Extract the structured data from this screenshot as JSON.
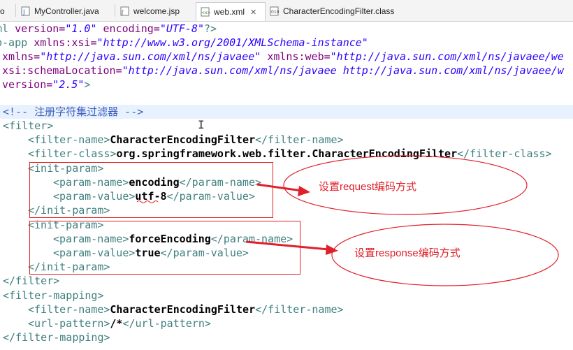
{
  "tabs": [
    {
      "label": "o",
      "icon": "java-file-icon"
    },
    {
      "label": "MyController.java",
      "icon": "java-file-icon"
    },
    {
      "label": "welcome.jsp",
      "icon": "jsp-file-icon"
    },
    {
      "label": "web.xml",
      "icon": "xml-file-icon",
      "close": "✕"
    },
    {
      "label": "CharacterEncodingFilter.class",
      "icon": "class-file-icon"
    }
  ],
  "code": {
    "l1": [
      "ml ",
      "version=",
      "\"1.0\"",
      " encoding=",
      "\"UTF-8\"",
      "?>"
    ],
    "l2": [
      "b-app ",
      "xmlns:xsi=",
      "\"http://www.w3.org/2001/XMLSchema-instance\""
    ],
    "l3": [
      " xmlns=",
      "\"http://java.sun.com/xml/ns/javaee\"",
      " xmlns:web=",
      "\"http://java.sun.com/xml/ns/javaee/we"
    ],
    "l4": [
      " xsi:schemaLocation=",
      "\"http://java.sun.com/xml/ns/javaee http://java.sun.com/xml/ns/javaee/w"
    ],
    "l5": [
      " version=",
      "\"2.5\"",
      ">"
    ],
    "l7": "<!-- 注册字符集过滤器 -->",
    "filter_open": "<filter>",
    "filter_name_open": "<filter-name>",
    "filter_name_value": "CharacterEncodingFilter",
    "filter_name_close": "</filter-name>",
    "filter_class_open": "<filter-class>",
    "filter_class_value": "org.springframework.web.filter.CharacterEncodingFilter",
    "filter_class_close": "</filter-class>",
    "init_param_open": "<init-param>",
    "param_name_open": "<param-name>",
    "param_name_close": "</param-name>",
    "param_value_open": "<param-value>",
    "param_value_close": "</param-value>",
    "p1_name": "encoding",
    "p1_value": "utf-8",
    "init_param_close": "</init-param>",
    "p2_name": "forceEncoding",
    "p2_value": "true",
    "filter_close": "</filter>",
    "mapping_open": "<filter-mapping>",
    "url_pattern_open": "<url-pattern>",
    "url_pattern_value": "/*",
    "url_pattern_close": "</url-pattern>",
    "mapping_close": "</filter-mapping>"
  },
  "annotations": {
    "request": "设置request编码方式",
    "response": "设置response编码方式",
    "color": "#e0202a"
  }
}
